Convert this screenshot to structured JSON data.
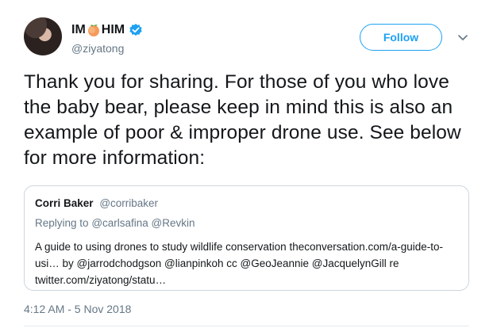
{
  "user": {
    "display_name_before": "IM",
    "display_name_after": "HIM",
    "emoji_icon": "peach-emoji",
    "verified_icon": "verified-badge-icon",
    "handle": "@ziyatong"
  },
  "follow_button": {
    "label": "Follow"
  },
  "menu_icon": "chevron-down-icon",
  "tweet": {
    "text": "Thank you for sharing. For those of you who love the baby bear, please keep in mind this is also an example of poor & improper drone use. See below for more information:",
    "timestamp": "4:12 AM - 5 Nov 2018"
  },
  "quoted_tweet": {
    "name": "Corri Baker",
    "handle": "@corribaker",
    "replying_label": "Replying to",
    "replying_to": "@carlsafina @Revkin",
    "text": "A guide to using drones to study wildlife conservation theconversation.com/a-guide-to-usi… by @jarrodchodgson @lianpinkoh cc @GeoJeannie @JacquelynGill re twitter.com/ziyatong/statu…"
  },
  "colors": {
    "accent": "#1da1f2",
    "secondary_text": "#657786",
    "border": "#ccd6dd",
    "peach": "#f7a35c"
  }
}
